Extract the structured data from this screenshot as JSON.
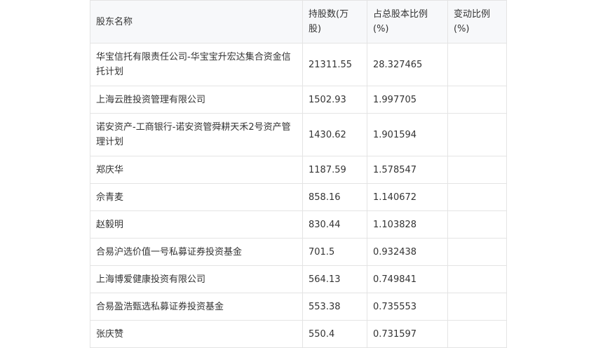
{
  "table": {
    "headers": [
      "股东名称",
      "持股数(万股)",
      "占总股本比例(%)",
      "变动比例(%)"
    ],
    "rows": [
      {
        "name": "华宝信托有限责任公司-华宝宝升宏达集合资金信托计划",
        "shares": "21311.55",
        "ratio": "28.327465",
        "change": ""
      },
      {
        "name": "上海云胜投资管理有限公司",
        "shares": "1502.93",
        "ratio": "1.997705",
        "change": ""
      },
      {
        "name": "诺安资产-工商银行-诺安资管舜耕天禾2号资产管理计划",
        "shares": "1430.62",
        "ratio": "1.901594",
        "change": ""
      },
      {
        "name": "郑庆华",
        "shares": "1187.59",
        "ratio": "1.578547",
        "change": ""
      },
      {
        "name": "佘青麦",
        "shares": "858.16",
        "ratio": "1.140672",
        "change": ""
      },
      {
        "name": "赵毅明",
        "shares": "830.44",
        "ratio": "1.103828",
        "change": ""
      },
      {
        "name": "合易沪选价值一号私募证券投资基金",
        "shares": "701.5",
        "ratio": "0.932438",
        "change": ""
      },
      {
        "name": "上海博爱健康投资有限公司",
        "shares": "564.13",
        "ratio": "0.749841",
        "change": ""
      },
      {
        "name": "合易盈浩甄选私募证券投资基金",
        "shares": "553.38",
        "ratio": "0.735553",
        "change": ""
      },
      {
        "name": "张庆赞",
        "shares": "550.4",
        "ratio": "0.731597",
        "change": ""
      }
    ]
  }
}
